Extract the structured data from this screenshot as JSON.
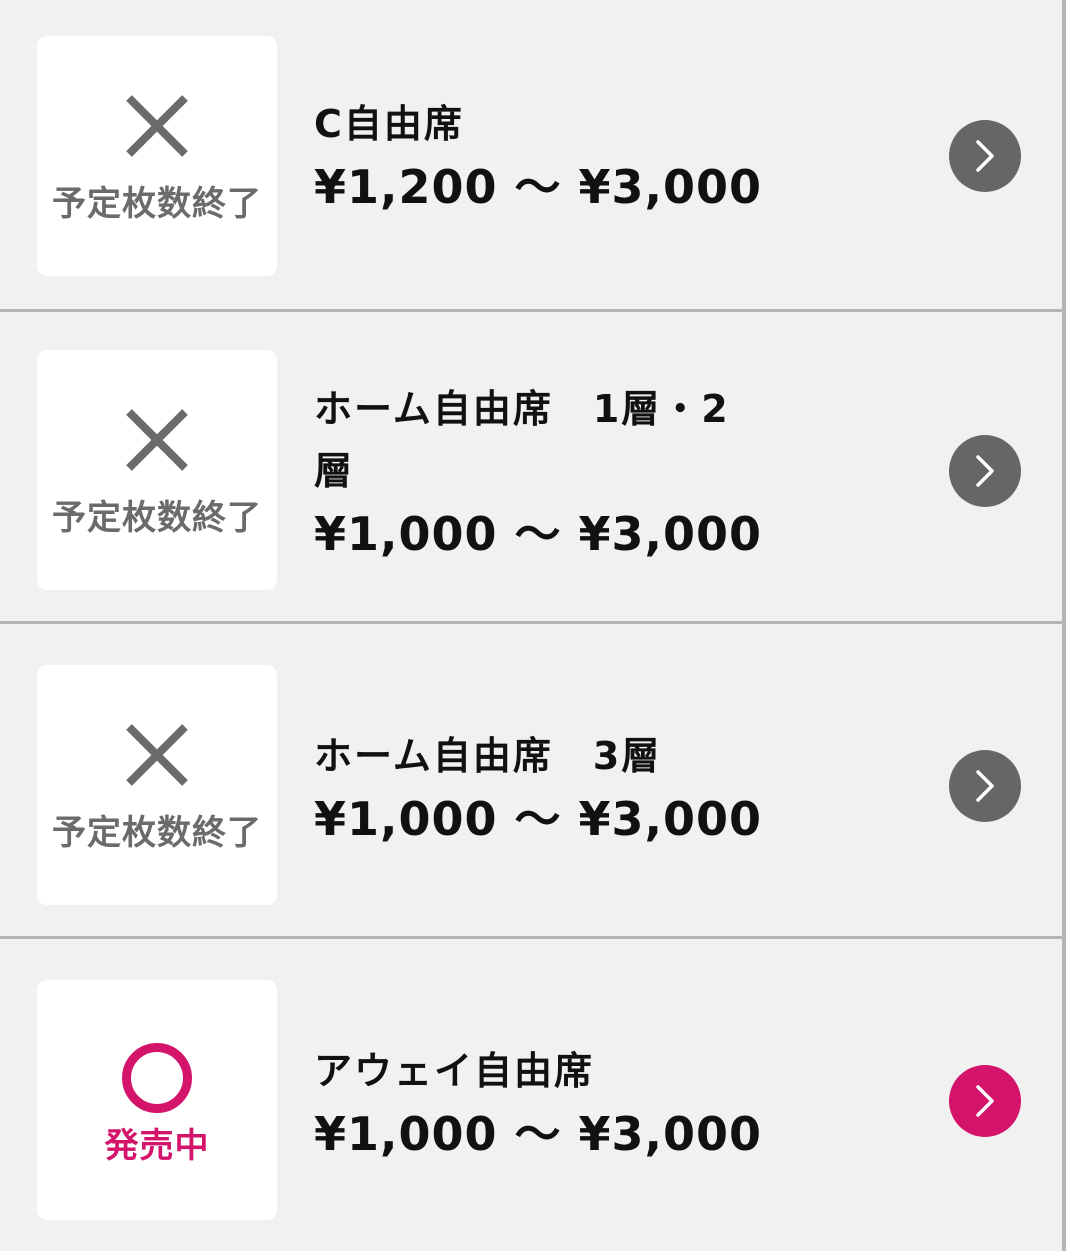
{
  "seats": [
    {
      "name": "C自由席",
      "price": "¥1,200 〜 ¥3,000",
      "status_label": "予定枚数終了",
      "status_icon": "cross-icon",
      "status_color": "#6b6b6b",
      "available": false
    },
    {
      "name": "ホーム自由席　1層・2層",
      "price": "¥1,000 〜 ¥3,000",
      "status_label": "予定枚数終了",
      "status_icon": "cross-icon",
      "status_color": "#6b6b6b",
      "available": false
    },
    {
      "name": "ホーム自由席　3層",
      "price": "¥1,000 〜 ¥3,000",
      "status_label": "予定枚数終了",
      "status_icon": "cross-icon",
      "status_color": "#6b6b6b",
      "available": false
    },
    {
      "name": "アウェイ自由席",
      "price": "¥1,000 〜 ¥3,000",
      "status_label": "発売中",
      "status_icon": "circle-icon",
      "status_color": "#d4136b",
      "available": true
    }
  ],
  "colors": {
    "accent": "#d4136b",
    "disabled": "#666666",
    "background": "#f1f1f1",
    "divider": "#b5b5b5"
  }
}
